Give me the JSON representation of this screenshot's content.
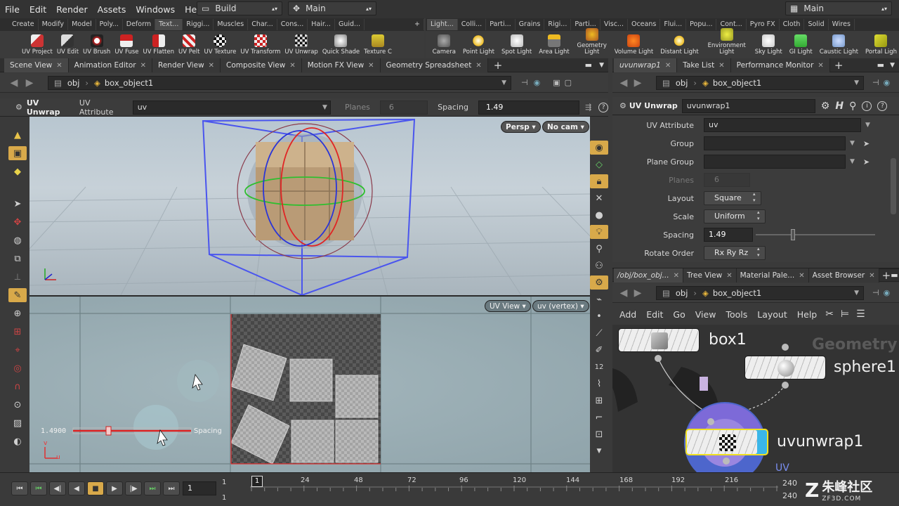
{
  "menubar": {
    "items": [
      "File",
      "Edit",
      "Render",
      "Assets",
      "Windows",
      "Help"
    ],
    "build_desk": "Build",
    "main_desk": "Main",
    "right_desk": "Main"
  },
  "shelf_left": {
    "tabs": [
      "Create",
      "Modify",
      "Model",
      "Poly...",
      "Deform",
      "Text...",
      "Riggi...",
      "Muscles",
      "Char...",
      "Cons...",
      "Hair...",
      "Guid..."
    ],
    "tools": [
      "UV Project",
      "UV Edit",
      "UV Brush",
      "UV Fuse",
      "UV Flatten",
      "UV Pelt",
      "UV Texture",
      "UV Transform",
      "UV Unwrap",
      "Quick Shade",
      "Texture C"
    ]
  },
  "shelf_right": {
    "tabs": [
      "Light...",
      "Colli...",
      "Parti...",
      "Grains",
      "Rigi...",
      "Parti...",
      "Visc...",
      "Oceans",
      "Flui...",
      "Popu...",
      "Cont...",
      "Pyro FX",
      "Cloth",
      "Solid",
      "Wires"
    ],
    "tools": [
      "Camera",
      "Point Light",
      "Spot Light",
      "Area Light",
      "Geometry Light",
      "Volume Light",
      "Distant Light",
      "Environment Light",
      "Sky Light",
      "GI Light",
      "Caustic Light",
      "Portal Ligh"
    ]
  },
  "viewer": {
    "tabs": [
      "Scene View",
      "Animation Editor",
      "Render View",
      "Composite View",
      "Motion FX View",
      "Geometry Spreadsheet"
    ],
    "path_root": "obj",
    "path_node": "box_object1",
    "op_name": "UV Unwrap",
    "uv_attr_label": "UV Attribute",
    "uv_attr_value": "uv",
    "planes_label": "Planes",
    "planes_value": "6",
    "spacing_label": "Spacing",
    "spacing_value": "1.49",
    "persp": "Persp",
    "cam": "No cam",
    "uv_view": "UV View",
    "uv_vertex": "uv (vertex)",
    "handle_value": "1.4900",
    "handle_label": "Spacing",
    "axis_v": "v",
    "axis_u": "u"
  },
  "params": {
    "tabs": [
      "uvunwrap1",
      "Take List",
      "Performance Monitor"
    ],
    "path_root": "obj",
    "path_node": "box_object1",
    "op_type": "UV Unwrap",
    "op_name": "uvunwrap1",
    "rows": {
      "uv_attribute": {
        "label": "UV Attribute",
        "value": "uv"
      },
      "group": {
        "label": "Group",
        "value": ""
      },
      "plane_group": {
        "label": "Plane Group",
        "value": ""
      },
      "planes": {
        "label": "Planes",
        "value": "6"
      },
      "layout": {
        "label": "Layout",
        "value": "Square"
      },
      "scale": {
        "label": "Scale",
        "value": "Uniform"
      },
      "spacing": {
        "label": "Spacing",
        "value": "1.49"
      },
      "rotate_order": {
        "label": "Rotate Order",
        "value": "Rx Ry Rz"
      }
    }
  },
  "network": {
    "tabs": [
      "/obj/box_obj...",
      "Tree View",
      "Material Pale...",
      "Asset Browser"
    ],
    "path_root": "obj",
    "path_node": "box_object1",
    "menu": [
      "Add",
      "Edit",
      "Go",
      "View",
      "Tools",
      "Layout",
      "Help"
    ],
    "context_label": "Geometry",
    "nodes": {
      "box": "box1",
      "sphere": "sphere1",
      "unwrap": "uvunwrap1"
    },
    "uv_badge": "UV"
  },
  "timeline": {
    "frame": "1",
    "start": "1",
    "end": "240",
    "end2": "240",
    "cur": "1",
    "ticks": [
      "24",
      "48",
      "72",
      "96",
      "120",
      "144",
      "168",
      "192",
      "216"
    ]
  },
  "watermark": {
    "text": "朱峰社区",
    "sub": "ZF3D.COM"
  }
}
